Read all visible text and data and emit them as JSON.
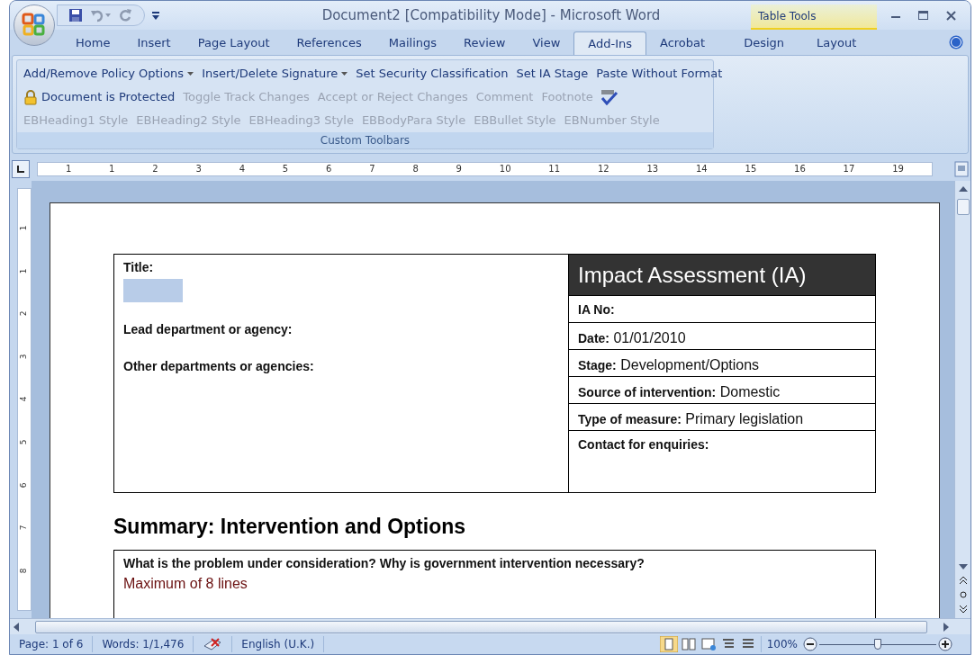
{
  "window": {
    "title": "Document2 [Compatibility Mode] - Microsoft Word",
    "contextual_group": "Table Tools"
  },
  "tabs": [
    {
      "label": "Home",
      "selected": false
    },
    {
      "label": "Insert",
      "selected": false
    },
    {
      "label": "Page Layout",
      "selected": false
    },
    {
      "label": "References",
      "selected": false
    },
    {
      "label": "Mailings",
      "selected": false
    },
    {
      "label": "Review",
      "selected": false
    },
    {
      "label": "View",
      "selected": false
    },
    {
      "label": "Add-Ins",
      "selected": true
    },
    {
      "label": "Acrobat",
      "selected": false
    }
  ],
  "contextual_tabs": [
    {
      "label": "Design",
      "selected": false
    },
    {
      "label": "Layout",
      "selected": false
    }
  ],
  "ribbon": {
    "group_label": "Custom Toolbars",
    "toolbars": [
      {
        "commands": [
          {
            "kind": "dropdown",
            "label": "Add/Remove Policy Options",
            "disabled": false
          },
          {
            "kind": "dropdown",
            "label": "Insert/Delete Signature",
            "disabled": false
          },
          {
            "kind": "command",
            "label": "Set Security Classification",
            "disabled": false
          },
          {
            "kind": "command",
            "label": "Set IA Stage",
            "disabled": false
          },
          {
            "kind": "command",
            "label": "Paste Without Format",
            "disabled": false
          }
        ]
      },
      {
        "commands": [
          {
            "kind": "protected",
            "label": "Document is Protected",
            "disabled": false
          },
          {
            "kind": "command",
            "label": "Toggle Track Changes",
            "disabled": true
          },
          {
            "kind": "command",
            "label": "Accept or Reject Changes",
            "disabled": true
          },
          {
            "kind": "command",
            "label": "Comment",
            "disabled": true
          },
          {
            "kind": "command",
            "label": "Footnote",
            "disabled": true
          },
          {
            "kind": "spell_check"
          }
        ]
      },
      {
        "commands": [
          {
            "kind": "command",
            "label": "EBHeading1 Style",
            "disabled": true
          },
          {
            "kind": "command",
            "label": "EBHeading2 Style",
            "disabled": true
          },
          {
            "kind": "command",
            "label": "EBHeading3 Style",
            "disabled": true
          },
          {
            "kind": "command",
            "label": "EBBodyPara Style",
            "disabled": true
          },
          {
            "kind": "command",
            "label": "EBBullet Style",
            "disabled": true
          },
          {
            "kind": "command",
            "label": "EBNumber Style",
            "disabled": true
          }
        ]
      }
    ]
  },
  "ruler": {
    "numbers": [
      "1",
      "1",
      "2",
      "3",
      "4",
      "5",
      "6",
      "7",
      "8",
      "9",
      "10",
      "11",
      "12",
      "13",
      "14",
      "15",
      "16",
      "17",
      "19"
    ],
    "vertical_numbers": [
      "1",
      "1",
      "2",
      "3",
      "4",
      "5",
      "6",
      "7",
      "8"
    ]
  },
  "document": {
    "left_fields": [
      {
        "kind": "with_entry_box",
        "label": "Title:"
      },
      {
        "kind": "plain",
        "label": "Lead department or agency:"
      },
      {
        "kind": "plain",
        "label": "Other departments or agencies:"
      }
    ],
    "header": "Impact Assessment (IA)",
    "right_fields": [
      {
        "label": "IA No:"
      },
      {
        "label": "Date:",
        "value": "01/01/2010"
      },
      {
        "label": "Stage:",
        "value": "Development/Options"
      },
      {
        "label": "Source of intervention:",
        "value": "Domestic"
      },
      {
        "label": "Type of measure:",
        "value": "Primary legislation"
      },
      {
        "label": "Contact for enquiries:"
      }
    ],
    "summary_heading": "Summary: Intervention and Options",
    "question": "What is the problem under consideration? Why is government intervention necessary?",
    "answer": "Maximum of 8 lines"
  },
  "status_bar": {
    "page": "Page: 1 of 6",
    "words": "Words: 1/1,476",
    "language": "English (U.K.)",
    "zoom": "100%",
    "zoom_slider": {
      "level": 0.5
    }
  }
}
